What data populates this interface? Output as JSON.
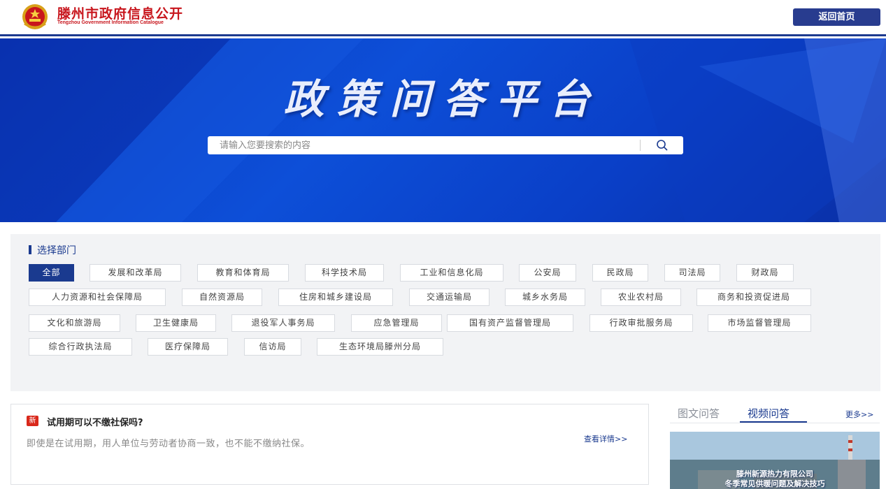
{
  "header": {
    "title": "滕州市政府信息公开",
    "subtitle": "Tengzhou Government Information Catalogue",
    "home_label": "返回首页"
  },
  "banner": {
    "title": "政策问答平台",
    "search_placeholder": "请输入您要搜索的内容"
  },
  "departments": {
    "heading": "选择部门",
    "selected": "全部",
    "items": [
      "全部",
      "发展和改革局",
      "教育和体育局",
      "科学技术局",
      "工业和信息化局",
      "公安局",
      "民政局",
      "司法局",
      "财政局",
      "人力资源和社会保障局",
      "自然资源局",
      "住房和城乡建设局",
      "交通运输局",
      "城乡水务局",
      "农业农村局",
      "商务和投资促进局",
      "文化和旅游局",
      "卫生健康局",
      "退役军人事务局",
      "应急管理局",
      "国有资产监督管理局",
      "行政审批服务局",
      "市场监督管理局",
      "综合行政执法局",
      "医疗保障局",
      "信访局",
      "生态环境局滕州分局"
    ]
  },
  "qa": {
    "badge": "新",
    "title": "试用期可以不缴社保吗?",
    "body": "即使是在试用期，用人单位与劳动者协商一致，也不能不缴纳社保。",
    "more_label": "查看详情>>"
  },
  "media": {
    "tabs": [
      "图文问答",
      "视频问答"
    ],
    "active_tab": "视频问答",
    "more_label": "更多>>",
    "video_caption_1": "滕州新源热力有限公司",
    "video_caption_2": "冬季常见供暖问题及解决技巧"
  },
  "colors": {
    "brand_red": "#c8161d",
    "primary_blue": "#1a3a8f",
    "banner_blue": "#0d4fd8"
  }
}
